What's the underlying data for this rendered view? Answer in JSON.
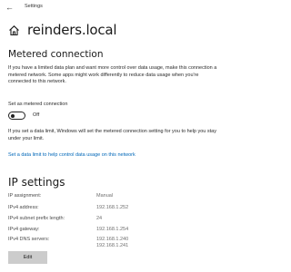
{
  "window": {
    "app_title": "Settings"
  },
  "header": {
    "title": "reinders.local",
    "home_icon": "home-icon"
  },
  "metered": {
    "title": "Metered connection",
    "description": "If you have a limited data plan and want more control over data usage, make this connection a metered network. Some apps might work differently to reduce data usage when you're connected to this network.",
    "toggle_label": "Set as metered connection",
    "toggle_on": false,
    "toggle_state": "Off",
    "limit_description": "If you set a data limit, Windows will set the metered connection setting for you to help you stay under your limit.",
    "link": "Set a data limit to help control data usage on this network"
  },
  "ip": {
    "title": "IP settings",
    "rows": [
      {
        "label": "IP assignment:",
        "value": "Manual"
      },
      {
        "label": "IPv4 address:",
        "value": "192.168.1.252"
      },
      {
        "label": "IPv4 subnet prefix length:",
        "value": "24"
      },
      {
        "label": "IPv4 gateway:",
        "value": "192.168.1.254"
      },
      {
        "label": "IPv4 DNS servers:",
        "value": "192.168.1.240",
        "value2": "192.168.1.241"
      }
    ],
    "edit_label": "Edit"
  }
}
